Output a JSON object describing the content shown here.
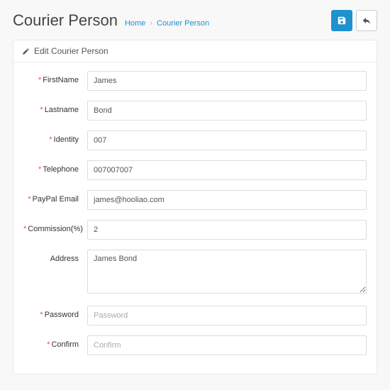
{
  "header": {
    "title": "Courier Person",
    "breadcrumb": {
      "home": "Home",
      "current": "Courier Person"
    }
  },
  "panel": {
    "heading": "Edit Courier Person"
  },
  "form": {
    "firstname": {
      "label": "FirstName",
      "value": "James"
    },
    "lastname": {
      "label": "Lastname",
      "value": "Bond"
    },
    "identity": {
      "label": "Identity",
      "value": "007"
    },
    "telephone": {
      "label": "Telephone",
      "value": "007007007"
    },
    "paypal": {
      "label": "PayPal Email",
      "value": "james@hooliao.com"
    },
    "commission": {
      "label": "Commission(%)",
      "value": "2"
    },
    "address": {
      "label": "Address",
      "value": "James Bond"
    },
    "password": {
      "label": "Password",
      "placeholder": "Password"
    },
    "confirm": {
      "label": "Confirm",
      "placeholder": "Confirm"
    }
  }
}
